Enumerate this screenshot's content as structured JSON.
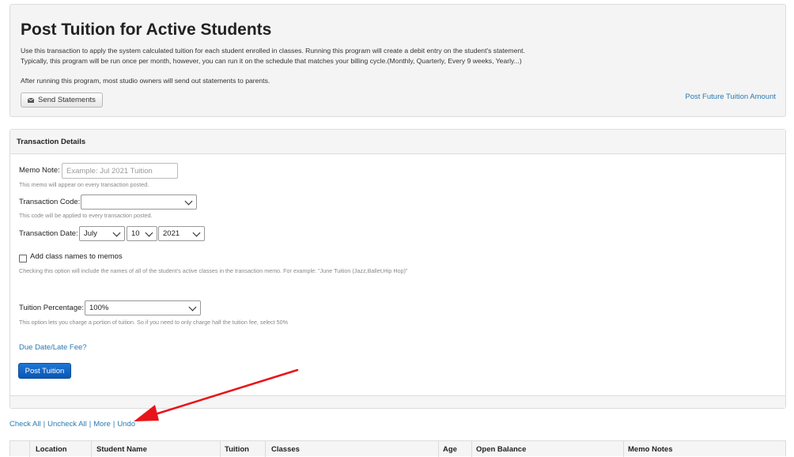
{
  "header": {
    "title": "Post Tuition for Active Students",
    "desc_line1": "Use this transaction to apply the system calculated tuition for each student enrolled in classes. Running this program will create a debit entry on the student's statement.",
    "desc_line2": "Typically, this program will be run once per month, however, you can run it on the schedule that matches your billing cycle.(Monthly, Quarterly, Every 9 weeks, Yearly...)",
    "desc_line3": "After running this program, most studio owners will send out statements to parents.",
    "send_statements_label": "Send Statements",
    "future_tuition_link": "Post Future Tuition Amount"
  },
  "panel": {
    "title": "Transaction Details",
    "memo_label": "Memo Note:",
    "memo_placeholder": "Example: Jul 2021 Tuition",
    "memo_value": "",
    "memo_help": "This memo will appear on every transaction posted.",
    "code_label": "Transaction Code:",
    "code_value": "",
    "code_help": "This code will be applied to every transaction posted.",
    "date_label": "Transaction Date:",
    "date_month": "July",
    "date_day": "10",
    "date_year": "2021",
    "class_names_label": "Add class names to memos",
    "class_names_checked": false,
    "class_names_help": "Checking this option will include the names of all of the student's active classes in the transaction memo. For example: \"June Tuition (Jazz,Ballet,Hip Hop)\"",
    "percent_label": "Tuition Percentage:",
    "percent_value": "100%",
    "percent_help": "This option lets you charge a portion of tuition. So if you need to only charge half the tuition fee, select 50%",
    "due_date_link": "Due Date/Late Fee?",
    "post_button": "Post Tuition"
  },
  "bulk_actions": {
    "check_all": "Check All",
    "uncheck_all": "Uncheck All",
    "more": "More",
    "undo": "Undo",
    "separator": "|"
  },
  "table": {
    "columns": [
      "Location",
      "Student Name",
      "Tuition",
      "Classes",
      "Age",
      "Open Balance",
      "Memo Notes"
    ]
  },
  "colors": {
    "link": "#2a7ab0",
    "primary_button": "#0b55b3",
    "annotation_arrow": "#e8141a"
  },
  "icons": {
    "send_statements": "envelope-icon",
    "select": "chevron-down-icon"
  }
}
